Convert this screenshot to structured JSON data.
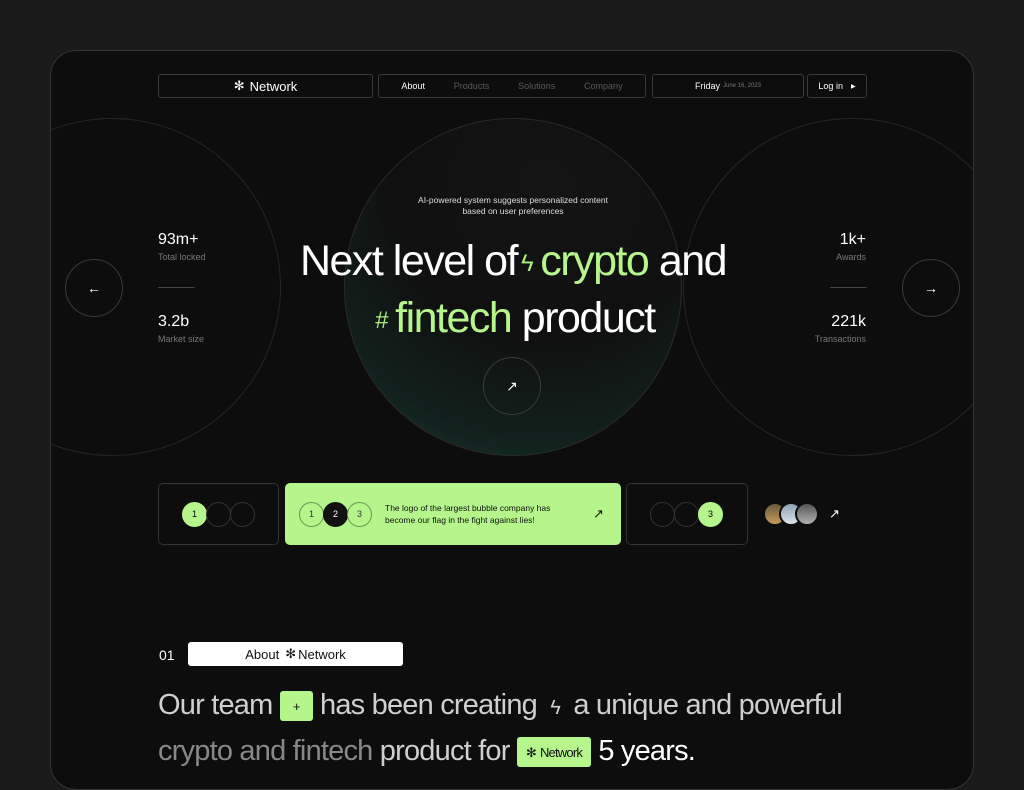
{
  "header": {
    "brand": "Network",
    "nav": [
      "About",
      "Products",
      "Solutions",
      "Company"
    ],
    "day": "Friday",
    "date": "June 16, 2023",
    "login": "Log in"
  },
  "hero": {
    "tagline": "AI-powered system suggests personalized content based on user preferences",
    "line1_a": "Next level of",
    "line1_b": "crypto",
    "line1_c": "and",
    "line2_a": "fintech",
    "line2_b": "product",
    "stats_left": [
      {
        "value": "93m+",
        "label": "Total locked"
      },
      {
        "value": "3.2b",
        "label": "Market size"
      }
    ],
    "stats_right": [
      {
        "value": "1k+",
        "label": "Awards"
      },
      {
        "value": "221k",
        "label": "Transactions"
      }
    ]
  },
  "cards": {
    "card1": [
      "1"
    ],
    "card2": [
      "1",
      "2",
      "3"
    ],
    "card2_text": "The logo of the largest bubble company has become our flag in the fight against lies!",
    "card3": [
      "3"
    ]
  },
  "about": {
    "number": "01",
    "label": "About",
    "brand": "Network",
    "t1": "Our team",
    "t2": "has been creating",
    "t3": "a unique and powerful",
    "t4": "crypto and fintech",
    "t5": "product for",
    "t6": "Network",
    "t7": "5 years."
  },
  "colors": {
    "accent": "#b5f58c",
    "background": "#0d0d0d"
  }
}
